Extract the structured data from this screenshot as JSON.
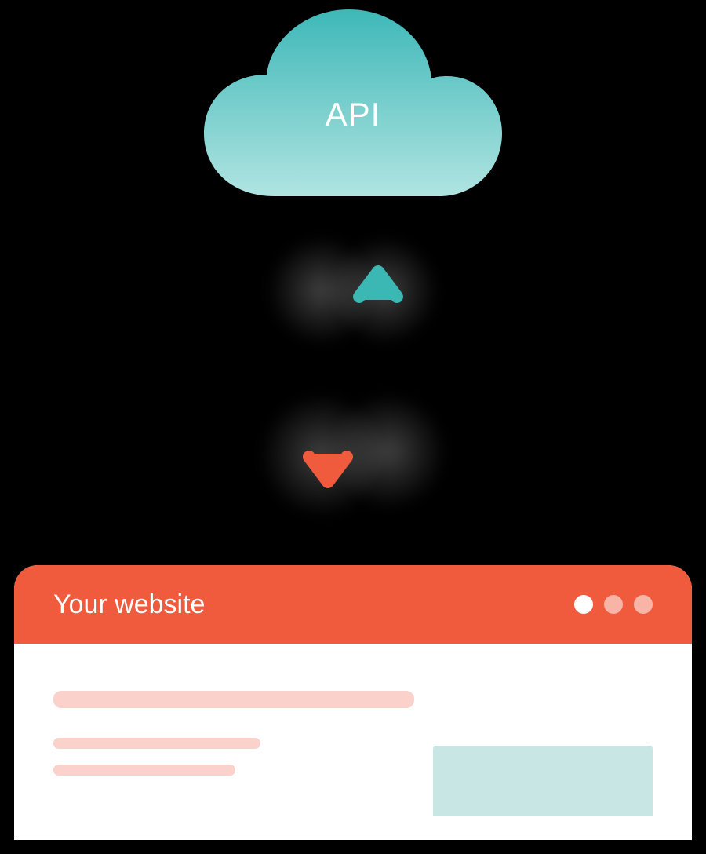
{
  "cloud": {
    "label": "API",
    "gradient_top": "#52c6c6",
    "gradient_bottom": "#a8e0dd"
  },
  "arrows": {
    "down_color": "#f05a3d",
    "up_color": "#3bb8b3"
  },
  "browser": {
    "title": "Your website",
    "titlebar_color": "#f05a3d",
    "placeholder_color": "#fad1cb",
    "accent_block_color": "#c8e6e4"
  }
}
